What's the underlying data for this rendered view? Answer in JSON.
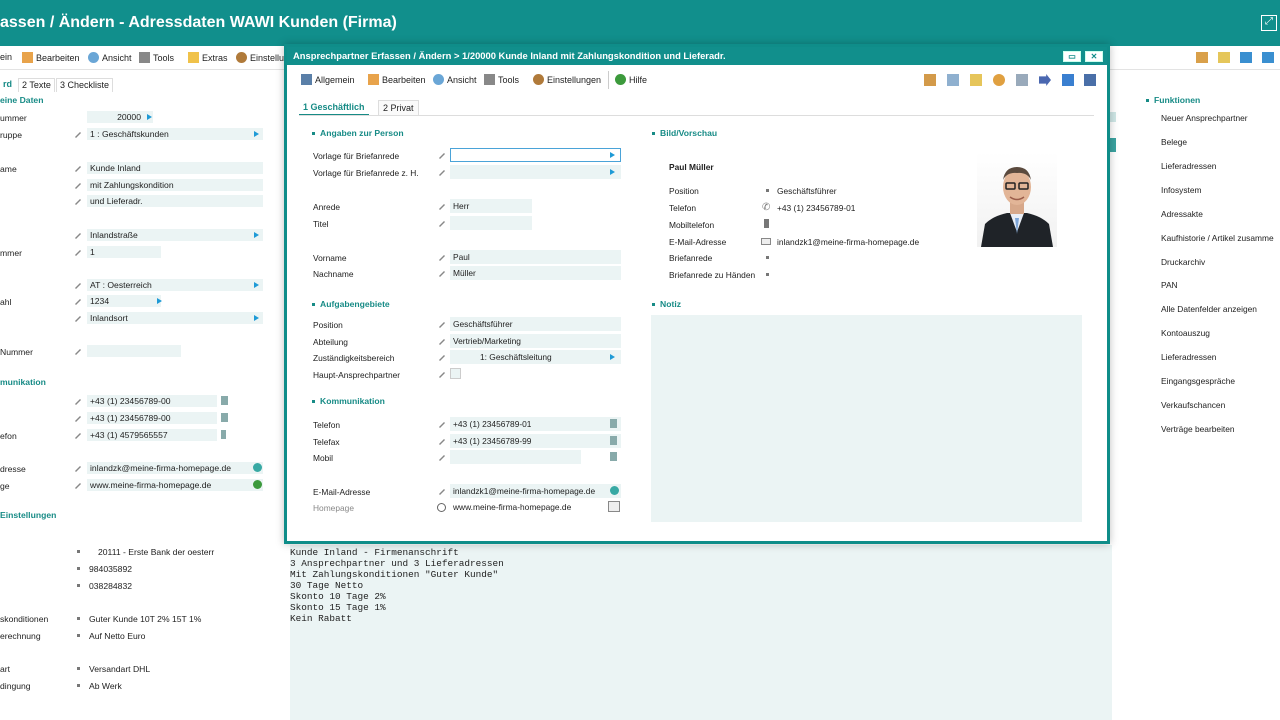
{
  "window": {
    "title": "assen / Ändern - Adressdaten WAWI Kunden (Firma)",
    "expand_icon": "expand-icon"
  },
  "toolbar": {
    "items": [
      "ein",
      "Bearbeiten",
      "Ansicht",
      "Tools",
      "Extras",
      "Einstellu"
    ]
  },
  "tabs": [
    "rd",
    "2 Texte",
    "3 Checkliste"
  ],
  "left": {
    "section_meine_daten": "eine Daten",
    "rows": [
      {
        "label": "ummer",
        "value": "20000"
      },
      {
        "label": "ruppe",
        "value": "1   : Geschäftskunden"
      },
      {
        "label": "ame",
        "value": "Kunde Inland"
      },
      {
        "label": "",
        "value": "mit Zahlungskondition"
      },
      {
        "label": "",
        "value": "und Lieferadr."
      },
      {
        "label": "",
        "value": "Inlandstraße"
      },
      {
        "label": "mmer",
        "value": "1"
      },
      {
        "label": "",
        "value": "AT    : Oesterreich"
      },
      {
        "label": "ahl",
        "value": "1234"
      },
      {
        "label": "",
        "value": "Inlandsort"
      },
      {
        "label": "Nummer",
        "value": ""
      }
    ],
    "section_kommunikation": "munikation",
    "komm": [
      {
        "label": "",
        "value": "+43 (1) 23456789-00"
      },
      {
        "label": "",
        "value": "+43 (1) 23456789-00"
      },
      {
        "label": "efon",
        "value": "+43 (1) 4579565557"
      },
      {
        "label": "dresse",
        "value": "inlandzk@meine-firma-homepage.de"
      },
      {
        "label": "ge",
        "value": "www.meine-firma-homepage.de"
      }
    ],
    "section_einstellungen": "Einstellungen",
    "einst": [
      {
        "label": "",
        "value": "20111 - Erste Bank der oesterr"
      },
      {
        "label": "",
        "value": "984035892"
      },
      {
        "label": "",
        "value": "038284832"
      },
      {
        "label": "skonditionen",
        "value": "Guter Kunde 10T 2% 15T 1%"
      },
      {
        "label": "erechnung",
        "value": "Auf Netto Euro"
      },
      {
        "label": "art",
        "value": "Versandart DHL"
      },
      {
        "label": "dingung",
        "value": "Ab Werk"
      }
    ]
  },
  "notes": "Kunde Inland - Firmenanschrift\n3 Ansprechpartner und 3 Lieferadressen\nMit Zahlungskonditionen \"Guter Kunde\"\n30 Tage Netto\nSkonto 10 Tage 2%\nSkonto 15 Tage 1%\nKein Rabatt",
  "functions": {
    "title": "Funktionen",
    "items": [
      "Neuer Ansprechpartner",
      "Belege",
      "Lieferadressen",
      "Infosystem",
      "Adressakte",
      "Kaufhistorie / Artikel zusamme",
      "Druckarchiv",
      "PAN",
      "Alle Datenfelder anzeigen",
      "Kontoauszug",
      "Lieferadressen",
      "Eingangsgespräche",
      "Verkaufschancen",
      "Verträge bearbeiten"
    ]
  },
  "dialog": {
    "title": "Ansprechpartner Erfassen / Ändern > 1/20000 Kunde Inland mit Zahlungskondition und Lieferadr.",
    "toolbar": [
      "Allgemein",
      "Bearbeiten",
      "Ansicht",
      "Tools",
      "Einstellungen",
      "Hilfe"
    ],
    "tabs": [
      "1 Geschäftlich",
      "2 Privat"
    ],
    "section_person": "Angaben zur Person",
    "person": [
      {
        "label": "Vorlage für Briefanrede",
        "value": ""
      },
      {
        "label": "Vorlage für Briefanrede z. H.",
        "value": ""
      },
      {
        "label": "Anrede",
        "value": "Herr"
      },
      {
        "label": "Titel",
        "value": ""
      },
      {
        "label": "Vorname",
        "value": "Paul"
      },
      {
        "label": "Nachname",
        "value": "Müller"
      }
    ],
    "section_aufgaben": "Aufgabengebiete",
    "aufgaben": [
      {
        "label": "Position",
        "value": "Geschäftsführer"
      },
      {
        "label": "Abteilung",
        "value": "Vertrieb/Marketing"
      },
      {
        "label": "Zuständigkeitsbereich",
        "value": "1: Geschäftsleitung"
      },
      {
        "label": "Haupt-Ansprechpartner",
        "value": ""
      }
    ],
    "section_komm": "Kommunikation",
    "komm": [
      {
        "label": "Telefon",
        "value": "+43 (1) 23456789-01"
      },
      {
        "label": "Telefax",
        "value": "+43 (1) 23456789-99"
      },
      {
        "label": "Mobil",
        "value": ""
      },
      {
        "label": "E-Mail-Adresse",
        "value": "inlandzk1@meine-firma-homepage.de"
      },
      {
        "label": "Homepage",
        "value": "www.meine-firma-homepage.de"
      }
    ],
    "section_bild": "Bild/Vorschau",
    "preview": {
      "name": "Paul Müller",
      "rows": [
        {
          "label": "Position",
          "value": "Geschäftsführer"
        },
        {
          "label": "Telefon",
          "value": "+43 (1) 23456789-01"
        },
        {
          "label": "Mobiltelefon",
          "value": ""
        },
        {
          "label": "E-Mail-Adresse",
          "value": "inlandzk1@meine-firma-homepage.de"
        },
        {
          "label": "Briefanrede",
          "value": ""
        },
        {
          "label": "Briefanrede zu Händen",
          "value": ""
        }
      ]
    },
    "section_notiz": "Notiz"
  },
  "colors": {
    "teal": "#118f8c",
    "field": "#ebf4f4",
    "accent_blue": "#1e9ad6"
  }
}
